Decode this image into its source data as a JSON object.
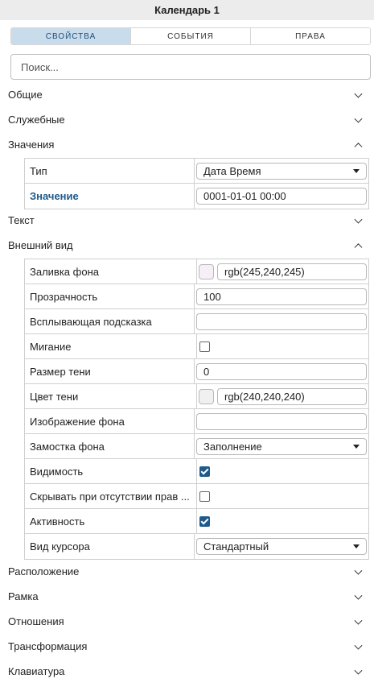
{
  "window": {
    "title": "Календарь 1"
  },
  "tabs": [
    {
      "label": "СВОЙСТВА",
      "active": true
    },
    {
      "label": "СОБЫТИЯ",
      "active": false
    },
    {
      "label": "ПРАВА",
      "active": false
    }
  ],
  "search": {
    "placeholder": "Поиск..."
  },
  "sections": {
    "general": {
      "label": "Общие",
      "expanded": false
    },
    "service": {
      "label": "Служебные",
      "expanded": false
    },
    "values": {
      "label": "Значения",
      "expanded": true
    },
    "text": {
      "label": "Текст",
      "expanded": false
    },
    "appearance": {
      "label": "Внешний вид",
      "expanded": true
    },
    "layout": {
      "label": "Расположение",
      "expanded": false
    },
    "frame": {
      "label": "Рамка",
      "expanded": false
    },
    "relations": {
      "label": "Отношения",
      "expanded": false
    },
    "transform": {
      "label": "Трансформация",
      "expanded": false
    },
    "keyboard": {
      "label": "Клавиатура",
      "expanded": false
    }
  },
  "values_props": {
    "type": {
      "label": "Тип",
      "value": "Дата Время"
    },
    "value": {
      "label": "Значение",
      "value": "0001-01-01 00:00"
    }
  },
  "appearance_props": {
    "bg_fill": {
      "label": "Заливка фона",
      "value": "rgb(245,240,245)",
      "swatch": "#f5f0f5"
    },
    "opacity": {
      "label": "Прозрачность",
      "value": "100"
    },
    "tooltip": {
      "label": "Всплывающая подсказка",
      "value": ""
    },
    "blink": {
      "label": "Мигание",
      "checked": false
    },
    "shadow_size": {
      "label": "Размер тени",
      "value": "0"
    },
    "shadow_color": {
      "label": "Цвет тени",
      "value": "rgb(240,240,240)",
      "swatch": "#f0f0f0"
    },
    "bg_image": {
      "label": "Изображение фона",
      "value": ""
    },
    "bg_tiling": {
      "label": "Замостка фона",
      "value": "Заполнение"
    },
    "visibility": {
      "label": "Видимость",
      "checked": true
    },
    "hide_no_rights": {
      "label": "Скрывать при отсутствии прав ...",
      "checked": false
    },
    "active": {
      "label": "Активность",
      "checked": true
    },
    "cursor": {
      "label": "Вид курсора",
      "value": "Стандартный"
    }
  },
  "colors": {
    "accent": "#1f5a8c",
    "tab_active_bg": "#c9dcec",
    "titlebar_bg": "#ececec"
  }
}
